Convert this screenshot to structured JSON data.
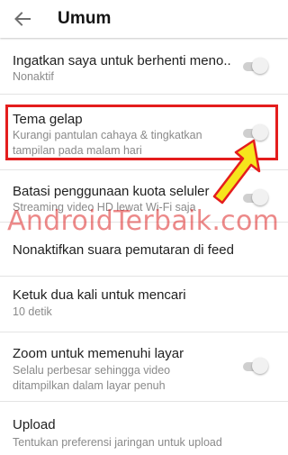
{
  "header": {
    "back_icon": "arrow-back-icon",
    "title": "Umum"
  },
  "settings": [
    {
      "label": "Ingatkan saya untuk berhenti meno..",
      "sub": "Nonaktif",
      "toggle": "off"
    },
    {
      "label": "Tema gelap",
      "sub": "Kurangi pantulan cahaya & tingkatkan tampilan pada malam hari",
      "toggle": "off"
    },
    {
      "label": "Batasi penggunaan kuota seluler",
      "sub": "Streaming video HD lewat Wi-Fi saja",
      "toggle": "off"
    },
    {
      "label": "Nonaktifkan suara pemutaran di feed",
      "sub": ""
    },
    {
      "label": "Ketuk dua kali untuk mencari",
      "sub": "10 detik"
    },
    {
      "label": "Zoom untuk memenuhi layar",
      "sub": "Selalu perbesar sehingga video ditampilkan dalam layar penuh",
      "toggle": "off"
    },
    {
      "label": "Upload",
      "sub": "Tentukan preferensi jaringan untuk upload"
    }
  ],
  "annotation": {
    "watermark": "AndroidTerbaik.com",
    "highlight_color": "#e41d1d",
    "arrow_fill": "#f6e51c",
    "arrow_stroke": "#e41d1d"
  }
}
